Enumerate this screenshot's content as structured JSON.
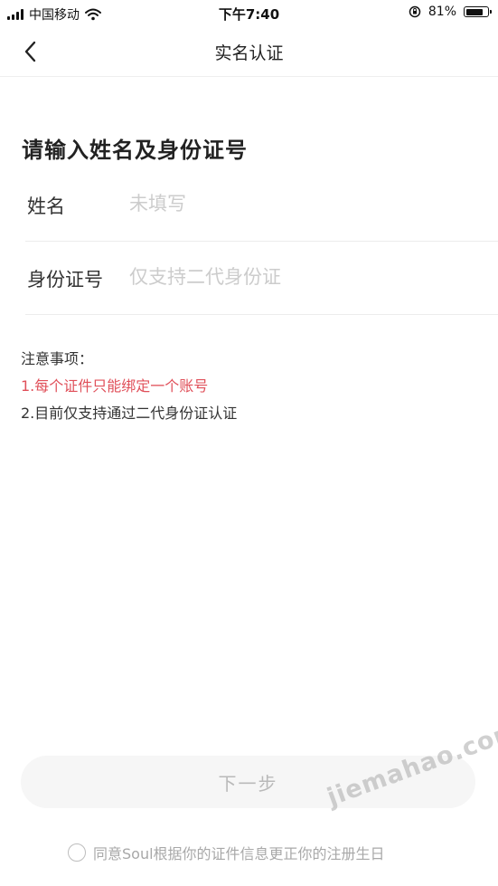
{
  "status_bar": {
    "carrier": "中国移动",
    "time": "下午7:40",
    "battery": "81%",
    "battery_level": 0.81
  },
  "nav": {
    "title": "实名认证",
    "back_icon": "chevron-left-icon"
  },
  "form": {
    "heading": "请输入姓名及身份证号",
    "fields": [
      {
        "label": "姓名",
        "value": "",
        "placeholder": "未填写"
      },
      {
        "label": "身份证号",
        "value": "",
        "placeholder": "仅支持二代身份证"
      }
    ]
  },
  "notes": {
    "title": "注意事项：",
    "items": [
      "1.每个证件只能绑定一个账号",
      "2.目前仅支持通过二代身份证认证"
    ]
  },
  "next_button": {
    "label": "下一步"
  },
  "agreement": {
    "text": "同意Soul根据你的证件信息更正你的注册生日",
    "checked": false
  },
  "watermark": {
    "text": "jiemahao.com"
  },
  "colors": {
    "warning_red": "#e0505a",
    "button_bg": "#f6f6f6",
    "placeholder": "#cccccc"
  }
}
